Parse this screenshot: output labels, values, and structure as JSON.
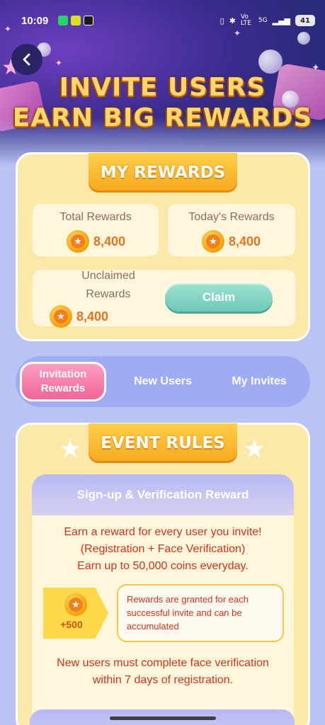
{
  "status_bar": {
    "time": "10:09",
    "signal_text": "Vo LTE",
    "network": "5G",
    "battery": "41"
  },
  "header": {
    "title_line1": "INVITE USERS",
    "title_line2": "EARN BIG REWARDS"
  },
  "my_rewards": {
    "ribbon": "MY REWARDS",
    "total_label": "Total Rewards",
    "total_value": "8,400",
    "today_label": "Today's Rewards",
    "today_value": "8,400",
    "unclaimed_label_line1": "Unclaimed",
    "unclaimed_label_line2": "Rewards",
    "unclaimed_value": "8,400",
    "claim_label": "Claim"
  },
  "tabs": {
    "invitation_line1": "Invitation",
    "invitation_line2": "Rewards",
    "new_users": "New Users",
    "my_invites": "My Invites"
  },
  "rules": {
    "ribbon": "EVENT RULES",
    "panel_title": "Sign-up & Verification Reward",
    "desc_line1": "Earn a reward for every user you invite!",
    "desc_line2": "(Registration + Face Verification)",
    "desc_line3": "Earn up to 50,000 coins everyday.",
    "bonus_amount": "+500",
    "bonus_note": "Rewards are granted for each successful invite and can be accumulated",
    "footer_line1": "New users must complete face verification",
    "footer_line2": "within 7 days of registration."
  },
  "colors": {
    "page_bg": "#b9c4f5",
    "card_bg": "#fce9a9",
    "ribbon": "#f7a81d",
    "accent_text": "#d0341c",
    "claim_button": "#6dc9b8",
    "active_tab": "#f0649a"
  },
  "icons": [
    "back-arrow-icon",
    "coin-star-icon",
    "star-icon",
    "bluetooth-icon",
    "signal-icon",
    "battery-icon"
  ]
}
